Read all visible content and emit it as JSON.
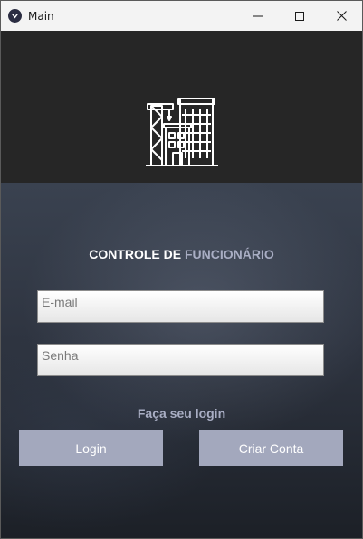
{
  "window": {
    "title": "Main",
    "controls": {
      "minimize": "minimize",
      "maximize": "maximize",
      "close": "close"
    }
  },
  "header": {
    "logo_icon": "buildings-icon"
  },
  "form": {
    "heading_part1": "CONTROLE DE ",
    "heading_part2": "FUNCIONÁRIO",
    "email_placeholder": "E-mail",
    "senha_placeholder": "Senha",
    "subtitle": "Faça seu login",
    "login_label": "Login",
    "criar_label": "Criar Conta"
  },
  "colors": {
    "accent": "#a9aec4",
    "button": "#a3a8bd",
    "header_bg": "#262626"
  }
}
